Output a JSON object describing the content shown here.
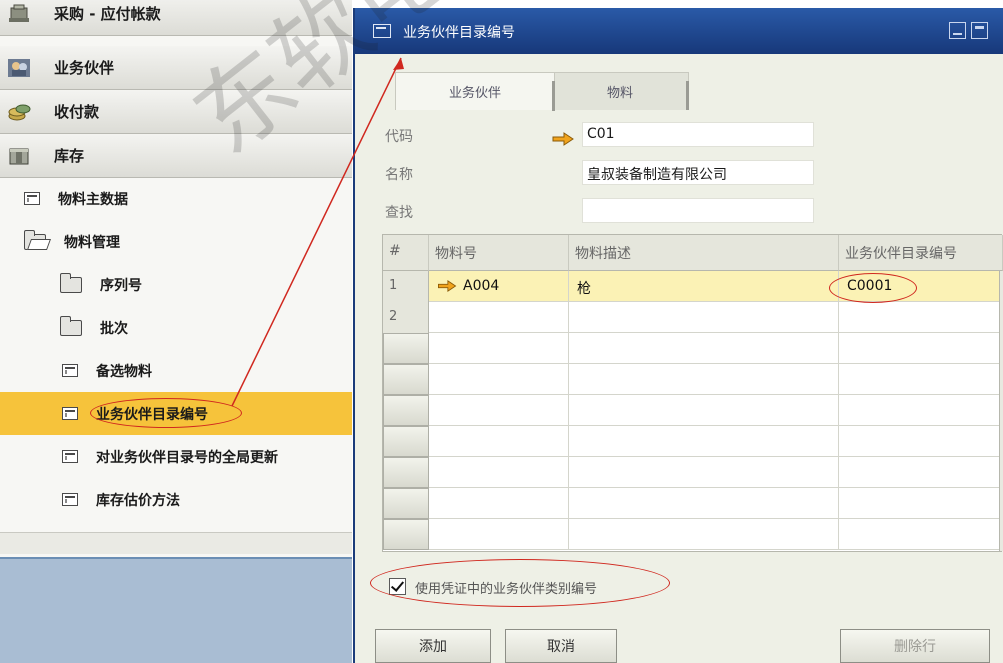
{
  "nav": {
    "modules": [
      {
        "label": "采购 - 应付帐款",
        "icon": "purchasing-icon"
      },
      {
        "label": "业务伙伴",
        "icon": "business-partner-icon"
      },
      {
        "label": "收付款",
        "icon": "banking-icon"
      },
      {
        "label": "库存",
        "icon": "inventory-icon"
      }
    ],
    "items": [
      {
        "label": "物料主数据",
        "icon": "form-icon"
      },
      {
        "label": "物料管理",
        "icon": "folder-open-icon"
      },
      {
        "label": "序列号",
        "icon": "folder-icon"
      },
      {
        "label": "批次",
        "icon": "folder-icon"
      },
      {
        "label": "备选物料",
        "icon": "form-icon"
      },
      {
        "label": "业务伙伴目录编号",
        "icon": "form-icon",
        "selected": true
      },
      {
        "label": "对业务伙伴目录号的全局更新",
        "icon": "form-icon"
      },
      {
        "label": "库存估价方法",
        "icon": "form-icon"
      }
    ]
  },
  "dialog": {
    "title": "业务伙伴目录编号",
    "tabs": [
      "业务伙伴",
      "物料"
    ],
    "fields": {
      "code_label": "代码",
      "code_value": "C01",
      "name_label": "名称",
      "name_value": "皇叔装备制造有限公司",
      "find_label": "查找",
      "find_value": ""
    },
    "grid": {
      "headers": [
        "#",
        "物料号",
        "物料描述",
        "业务伙伴目录编号"
      ],
      "rows": [
        {
          "num": "1",
          "item": "A004",
          "desc": "枪",
          "bp_catalog": "C0001"
        },
        {
          "num": "2",
          "item": "",
          "desc": "",
          "bp_catalog": ""
        }
      ],
      "empty_rows": 7
    },
    "checkbox_label": "使用凭证中的业务伙伴类别编号",
    "checkbox_checked": true,
    "buttons": {
      "add": "添加",
      "cancel": "取消",
      "delete_row": "删除行"
    }
  },
  "annotations": {
    "color": "#d0281f",
    "watermark": "东软电"
  },
  "colors": {
    "title_bar": "#17387a",
    "selected_nav": "#f6c33b",
    "active_row": "#fbf2b5",
    "link_arrow": "#f0a31c"
  }
}
